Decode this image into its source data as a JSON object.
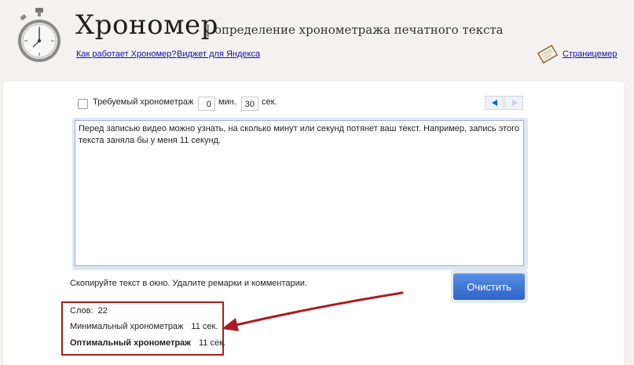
{
  "header": {
    "title": "Хрономер",
    "separator": "|",
    "subtitle": "определение хронометража печатного текста",
    "links": {
      "how": "Как работает Хрономер?",
      "widget": "Виджет для Яндекса",
      "meter": "Страницемер"
    },
    "icons": {
      "logo": "stopwatch-icon",
      "meter": "notepad-icon"
    }
  },
  "controls": {
    "required_label": "Требуемый хронометраж",
    "required_checked": false,
    "minutes": "0",
    "minutes_unit": "мин.",
    "seconds": "30",
    "seconds_unit": "сек.",
    "nav": {
      "prev": "arrow-left-icon",
      "next": "arrow-right-icon"
    }
  },
  "editor": {
    "text": "Перед записью видео можно узнать, на сколько минут или секунд потянет ваш текст. Например, запись этого текста заняла бы у меня 11 секунд."
  },
  "hint": "Скопируйте текст в окно. Удалите ремарки и комментарии.",
  "clear_button": "Очистить",
  "results": {
    "words_label": "Слов:",
    "words_value": "22",
    "min_label": "Минимальный хронометраж",
    "min_value": "11 сек.",
    "opt_label": "Оптимальный хронометраж",
    "opt_value": "11 сек."
  },
  "colors": {
    "accent_blue": "#2d64c8",
    "highlight_red": "#a81d20",
    "page_bg": "#f4f2ee"
  }
}
